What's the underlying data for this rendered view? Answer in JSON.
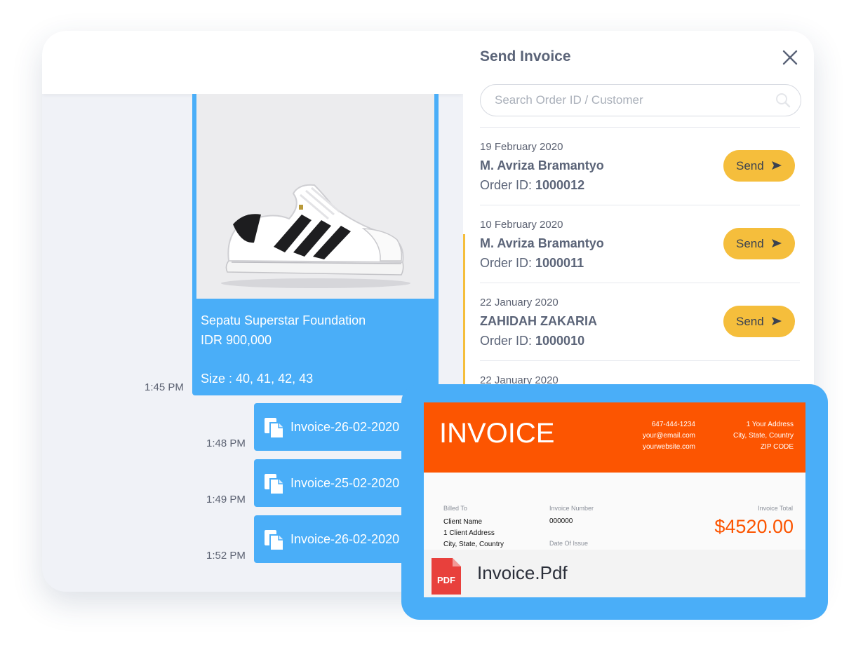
{
  "panel": {
    "title": "Send Invoice",
    "search_placeholder": "Search Order ID / Customer",
    "order_id_prefix": "Order ID: ",
    "send_label": "Send",
    "orders": [
      {
        "date": "19 February 2020",
        "name": "M. Avriza Bramantyo",
        "order_id": "1000012"
      },
      {
        "date": "10 February 2020",
        "name": "M. Avriza Bramantyo",
        "order_id": "1000011"
      },
      {
        "date": "22 January 2020",
        "name": "ZAHIDAH ZAKARIA",
        "order_id": "1000010"
      },
      {
        "date": "22 January 2020"
      }
    ]
  },
  "chat": {
    "product": {
      "name": "Sepatu Superstar Foundation",
      "price": "IDR 900,000",
      "size": "Size : 40, 41, 42, 43",
      "time": "1:45 PM"
    },
    "files": [
      {
        "name": "Invoice-26-02-2020",
        "time": "1:48 PM"
      },
      {
        "name": "Invoice-25-02-2020",
        "time": "1:49 PM"
      },
      {
        "name": "Invoice-26-02-2020",
        "time": "1:52 PM"
      }
    ]
  },
  "invoice": {
    "title": "INVOICE",
    "phone": "647-444-1234",
    "email": "your@email.com",
    "website": "yourwebsite.com",
    "address_line1": "1 Your Address",
    "address_line2": "City, State, Country",
    "address_line3": "ZIP CODE",
    "billed_to_label": "Billed To",
    "client_name": "Client Name",
    "client_address": "1 Client Address",
    "client_city": "City, State, Country",
    "invoice_number_label": "Invoice Number",
    "invoice_number": "000000",
    "date_of_issue_label": "Date Of Issue",
    "total_label": "Invoice Total",
    "total": "$4520.00",
    "pdf_icon_text": "PDF",
    "filename": "Invoice.Pdf"
  },
  "colors": {
    "chat_bubble": "#4aaef8",
    "send_button": "#f5be3c",
    "invoice_orange": "#fc5501",
    "pdf_red": "#e8403c",
    "text_dark": "#5b6478"
  },
  "icons": [
    "close-icon",
    "search-icon",
    "send-arrow-icon",
    "copy-file-icon",
    "pdf-icon"
  ]
}
